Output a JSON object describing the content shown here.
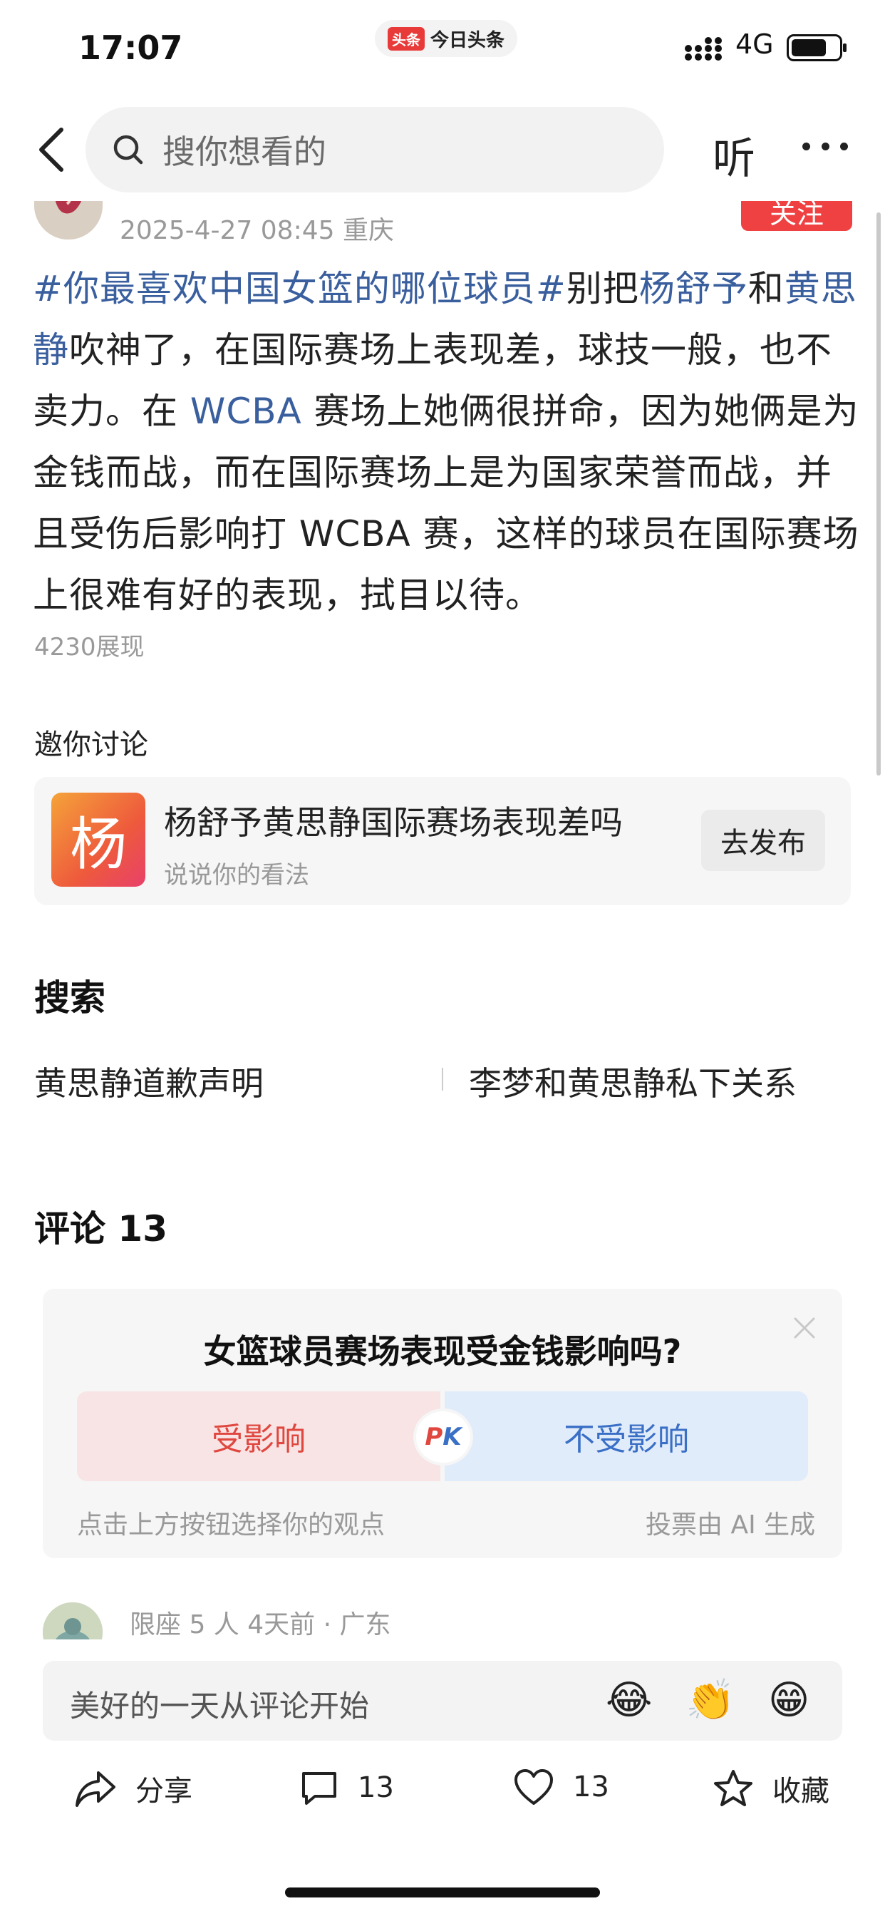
{
  "status_bar": {
    "time": "17:07",
    "app_badge": "头条",
    "app_name": "今日头条",
    "network": "4G"
  },
  "nav": {
    "search_placeholder": "搜你想看的",
    "listen_label": "听"
  },
  "post": {
    "meta": "2025-4-27 08:45  重庆",
    "follow_label": "关注",
    "hashtag": "#你最喜欢中国女篮的哪位球员#",
    "text_1": "别把",
    "mention_1": "杨舒予",
    "text_2": "和",
    "mention_2": "黄思静",
    "text_3": "吹神了，在国际赛场上表现差，球技一般，也不卖力。在 ",
    "mention_3": "WCBA",
    "text_4": " 赛场上她俩很拼命，因为她俩是为金钱而战，而在国际赛场上是为国家荣誉而战，并且受伤后影响打 WCBA 赛，这样的球员在国际赛场上很难有好的表现，拭目以待。",
    "impressions": "4230展现"
  },
  "invite": {
    "title": "邀你讨论",
    "icon_char": "杨",
    "topic": "杨舒予黄思静国际赛场表现差吗",
    "subtitle": "说说你的看法",
    "publish_label": "去发布"
  },
  "search": {
    "heading": "搜索",
    "items": [
      "黄思静道歉声明",
      "李梦和黄思静私下关系"
    ]
  },
  "comments": {
    "heading": "评论 13",
    "poll": {
      "question": "女篮球员赛场表现受金钱影响吗?",
      "option_a": "受影响",
      "option_b": "不受影响",
      "pk_p": "P",
      "pk_k": "K",
      "hint": "点击上方按钮选择你的观点",
      "ai_note": "投票由 AI 生成"
    },
    "first_comment_meta": "限座 5 人   4天前 · 广东"
  },
  "input": {
    "placeholder": "美好的一天从评论开始"
  },
  "actions": {
    "share_label": "分享",
    "comment_count": "13",
    "like_count": "13",
    "favorite_label": "收藏"
  }
}
